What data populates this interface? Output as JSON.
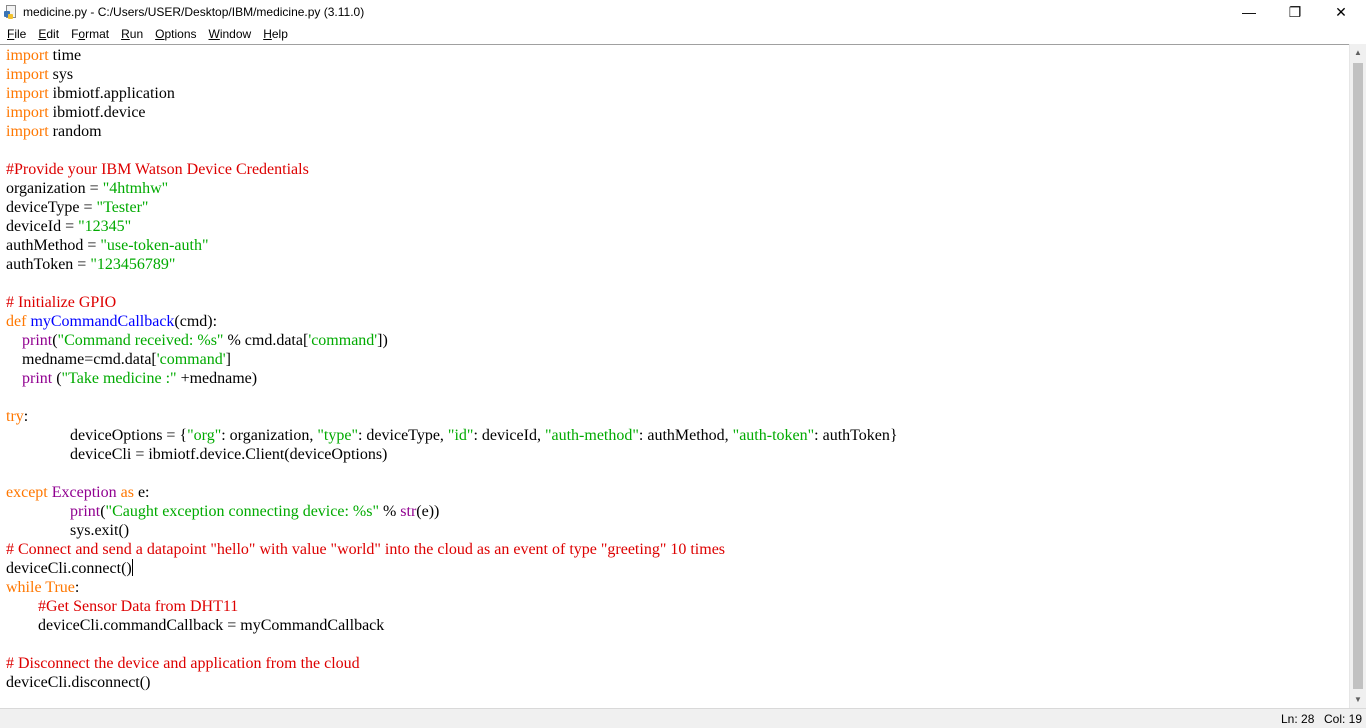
{
  "window": {
    "title": "medicine.py - C:/Users/USER/Desktop/IBM/medicine.py (3.11.0)",
    "minimize_glyph": "—",
    "maximize_glyph": "❐",
    "close_glyph": "✕"
  },
  "menu": [
    {
      "accel": "F",
      "rest": "ile"
    },
    {
      "accel": "E",
      "rest": "dit"
    },
    {
      "accel": "",
      "pre": "F",
      "accel2": "o",
      "rest": "rmat"
    },
    {
      "accel": "R",
      "rest": "un"
    },
    {
      "accel": "O",
      "rest": "ptions"
    },
    {
      "accel": "W",
      "rest": "indow"
    },
    {
      "accel": "H",
      "rest": "elp"
    }
  ],
  "code_lines": [
    [
      {
        "t": "import",
        "c": "kw"
      },
      {
        "t": " time"
      }
    ],
    [
      {
        "t": "import",
        "c": "kw"
      },
      {
        "t": " sys"
      }
    ],
    [
      {
        "t": "import",
        "c": "kw"
      },
      {
        "t": " ibmiotf.application"
      }
    ],
    [
      {
        "t": "import",
        "c": "kw"
      },
      {
        "t": " ibmiotf.device"
      }
    ],
    [
      {
        "t": "import",
        "c": "kw"
      },
      {
        "t": " random"
      }
    ],
    [],
    [
      {
        "t": "#Provide your IBM Watson Device Credentials",
        "c": "cmt"
      }
    ],
    [
      {
        "t": "organization = "
      },
      {
        "t": "\"4htmhw\"",
        "c": "str"
      }
    ],
    [
      {
        "t": "deviceType = "
      },
      {
        "t": "\"Tester\"",
        "c": "str"
      }
    ],
    [
      {
        "t": "deviceId = "
      },
      {
        "t": "\"12345\"",
        "c": "str"
      }
    ],
    [
      {
        "t": "authMethod = "
      },
      {
        "t": "\"use-token-auth\"",
        "c": "str"
      }
    ],
    [
      {
        "t": "authToken = "
      },
      {
        "t": "\"123456789\"",
        "c": "str"
      }
    ],
    [],
    [
      {
        "t": "# Initialize GPIO",
        "c": "cmt"
      }
    ],
    [
      {
        "t": "def",
        "c": "kw"
      },
      {
        "t": " "
      },
      {
        "t": "myCommandCallback",
        "c": "fn"
      },
      {
        "t": "(cmd):"
      }
    ],
    [
      {
        "t": "    "
      },
      {
        "t": "print",
        "c": "bi"
      },
      {
        "t": "("
      },
      {
        "t": "\"Command received: %s\"",
        "c": "str"
      },
      {
        "t": " % cmd.data["
      },
      {
        "t": "'command'",
        "c": "str"
      },
      {
        "t": "])"
      }
    ],
    [
      {
        "t": "    medname=cmd.data["
      },
      {
        "t": "'command'",
        "c": "str"
      },
      {
        "t": "]"
      }
    ],
    [
      {
        "t": "    "
      },
      {
        "t": "print",
        "c": "bi"
      },
      {
        "t": " ("
      },
      {
        "t": "\"Take medicine :\"",
        "c": "str"
      },
      {
        "t": " +medname)"
      }
    ],
    [],
    [
      {
        "t": "try",
        "c": "kw"
      },
      {
        "t": ":"
      }
    ],
    [
      {
        "t": "\t\tdeviceOptions = {"
      },
      {
        "t": "\"org\"",
        "c": "str"
      },
      {
        "t": ": organization, "
      },
      {
        "t": "\"type\"",
        "c": "str"
      },
      {
        "t": ": deviceType, "
      },
      {
        "t": "\"id\"",
        "c": "str"
      },
      {
        "t": ": deviceId, "
      },
      {
        "t": "\"auth-method\"",
        "c": "str"
      },
      {
        "t": ": authMethod, "
      },
      {
        "t": "\"auth-token\"",
        "c": "str"
      },
      {
        "t": ": authToken}"
      }
    ],
    [
      {
        "t": "\t\tdeviceCli = ibmiotf.device.Client(deviceOptions)"
      }
    ],
    [],
    [
      {
        "t": "except",
        "c": "kw"
      },
      {
        "t": " "
      },
      {
        "t": "Exception",
        "c": "bi"
      },
      {
        "t": " "
      },
      {
        "t": "as",
        "c": "kw"
      },
      {
        "t": " e:"
      }
    ],
    [
      {
        "t": "\t\t"
      },
      {
        "t": "print",
        "c": "bi"
      },
      {
        "t": "("
      },
      {
        "t": "\"Caught exception connecting device: %s\"",
        "c": "str"
      },
      {
        "t": " % "
      },
      {
        "t": "str",
        "c": "bi"
      },
      {
        "t": "(e))"
      }
    ],
    [
      {
        "t": "\t\tsys.exit()"
      }
    ],
    [
      {
        "t": "# Connect and send a datapoint \"hello\" with value \"world\" into the cloud as an event of type \"greeting\" 10 times",
        "c": "cmt"
      }
    ],
    [
      {
        "t": "deviceCli.connect()"
      },
      {
        "cursor": true
      }
    ],
    [
      {
        "t": "while",
        "c": "kw"
      },
      {
        "t": " "
      },
      {
        "t": "True",
        "c": "kw"
      },
      {
        "t": ":"
      }
    ],
    [
      {
        "t": "        "
      },
      {
        "t": "#Get Sensor Data from DHT11",
        "c": "cmt"
      }
    ],
    [
      {
        "t": "        deviceCli.commandCallback = myCommandCallback"
      }
    ],
    [],
    [
      {
        "t": "# Disconnect the device and application from the cloud",
        "c": "cmt"
      }
    ],
    [
      {
        "t": "deviceCli.disconnect()"
      }
    ]
  ],
  "status": {
    "line": "Ln: 28",
    "col": "Col: 19"
  }
}
